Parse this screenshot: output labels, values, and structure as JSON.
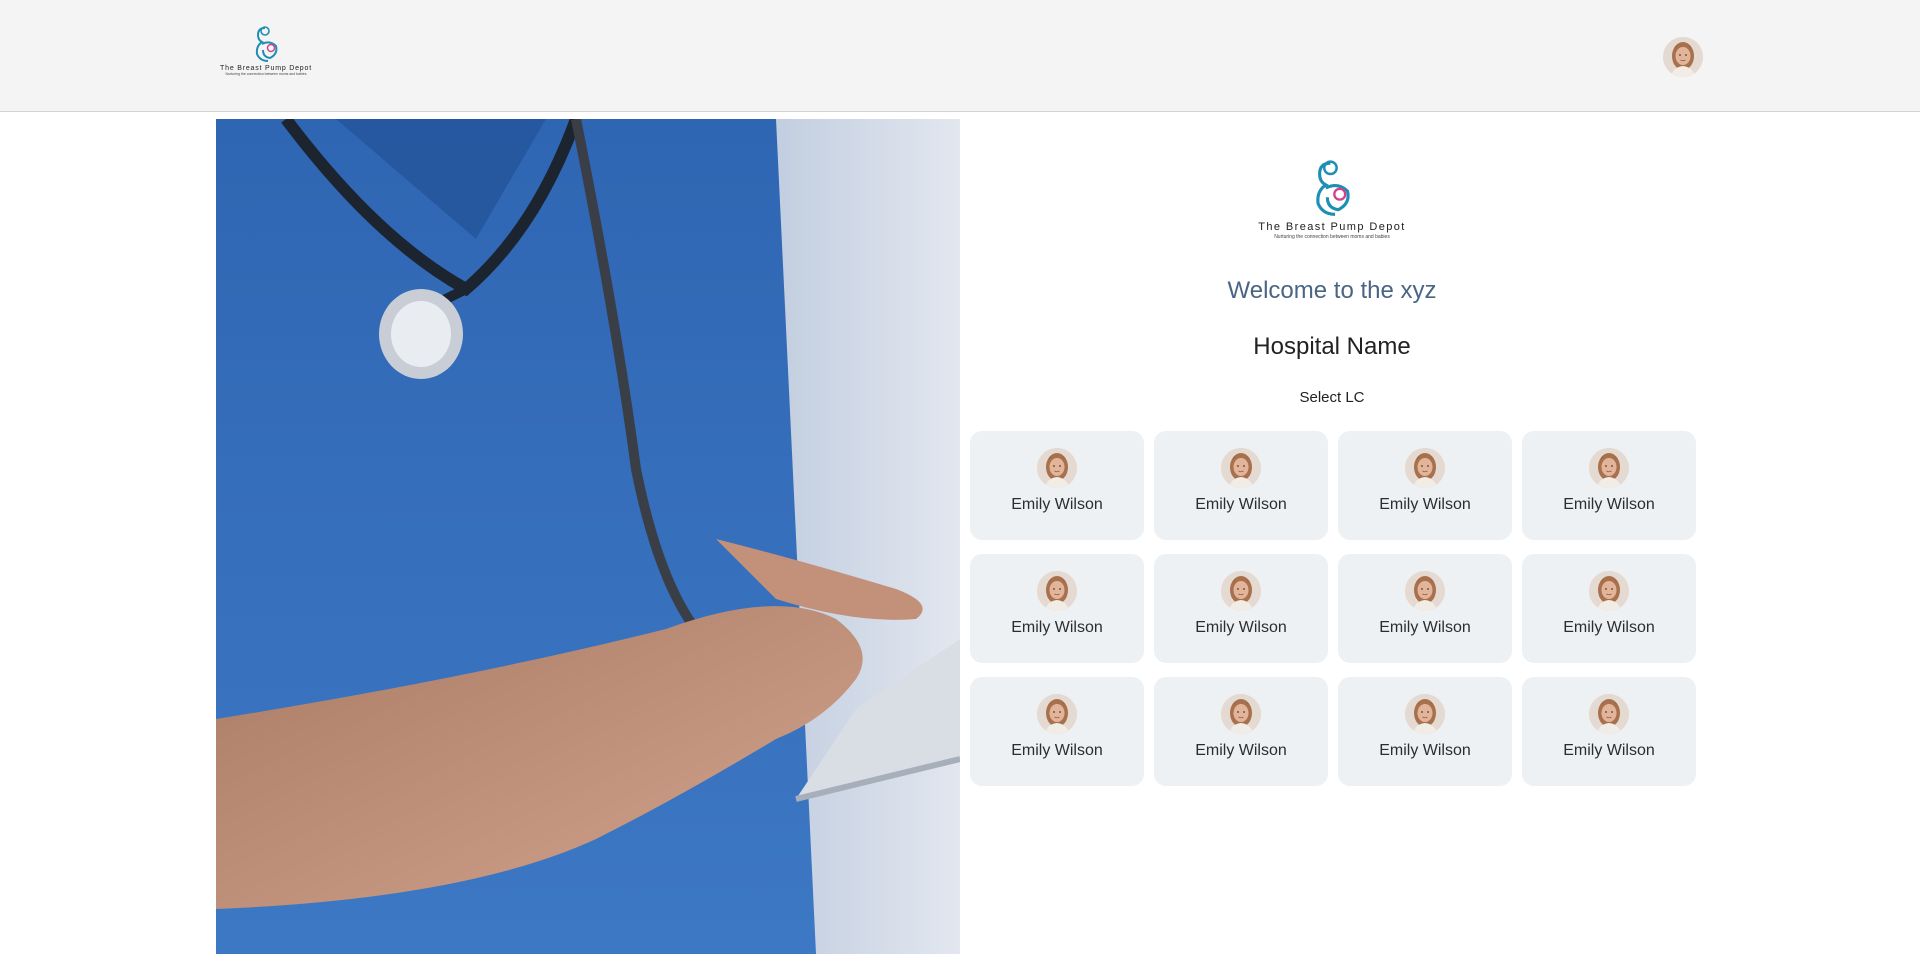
{
  "header": {
    "logo": {
      "brand": "The Breast Pump Depot",
      "tagline": "Nurturing the connection between moms and babies"
    },
    "avatar_icon": "user-avatar"
  },
  "main": {
    "logo": {
      "brand": "The Breast Pump Depot",
      "tagline": "Nurturing the connection between moms and babies"
    },
    "welcome": "Welcome to the xyz",
    "hospital_name": "Hospital Name",
    "select_label": "Select LC",
    "consultants": [
      {
        "name": "Emily Wilson"
      },
      {
        "name": "Emily Wilson"
      },
      {
        "name": "Emily Wilson"
      },
      {
        "name": "Emily Wilson"
      },
      {
        "name": "Emily Wilson"
      },
      {
        "name": "Emily Wilson"
      },
      {
        "name": "Emily Wilson"
      },
      {
        "name": "Emily Wilson"
      },
      {
        "name": "Emily Wilson"
      },
      {
        "name": "Emily Wilson"
      },
      {
        "name": "Emily Wilson"
      },
      {
        "name": "Emily Wilson"
      }
    ]
  },
  "colors": {
    "header_bg": "#f4f4f4",
    "card_bg": "#eef1f4",
    "welcome_text": "#4a6584",
    "logo_teal": "#1d8fb5",
    "logo_pink": "#d2418a"
  }
}
